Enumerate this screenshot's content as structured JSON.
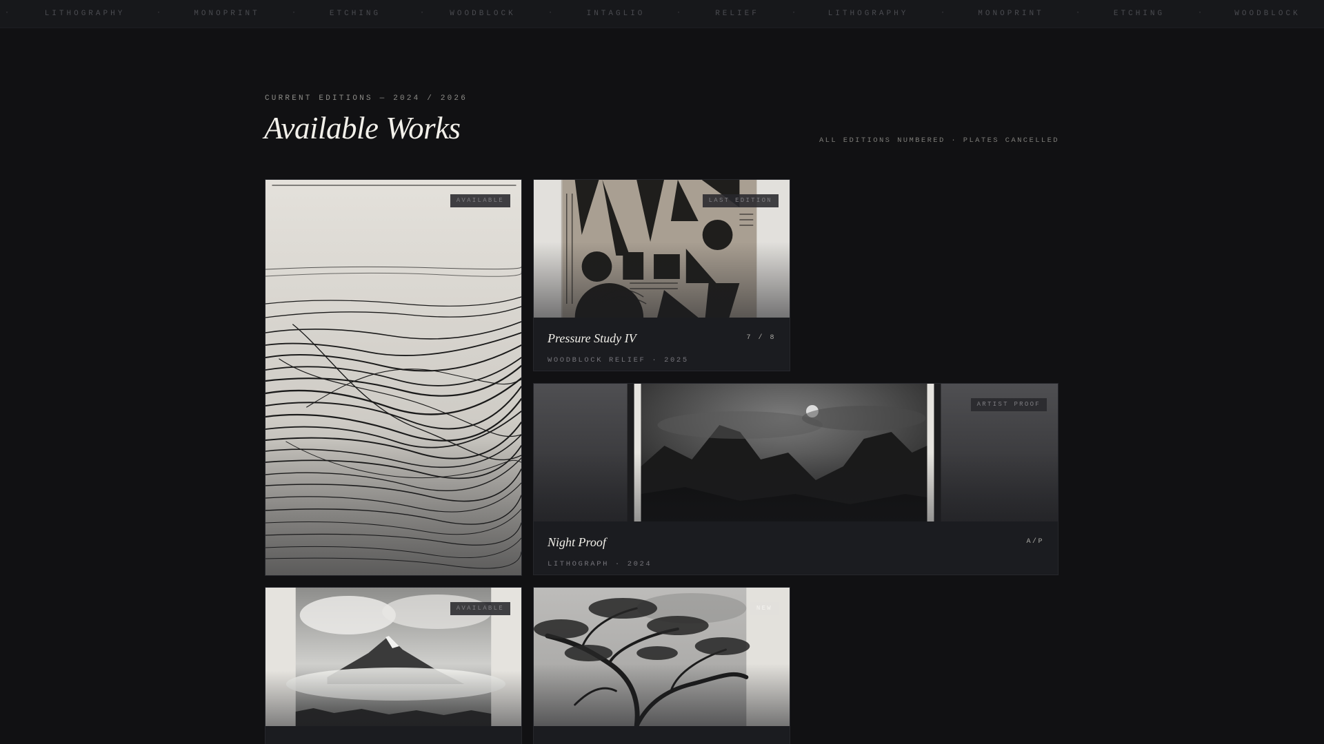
{
  "ticker": {
    "items": [
      "LITHOGRAPHY",
      "MONOPRINT",
      "ETCHING",
      "WOODBLOCK",
      "INTAGLIO",
      "RELIEF",
      "LITHOGRAPHY",
      "MONOPRINT",
      "ETCHING",
      "WOODBLOCK"
    ],
    "separator": "·"
  },
  "header": {
    "eyebrow": "CURRENT EDITIONS — 2024 / 2026",
    "title": "Available Works",
    "note": "ALL EDITIONS NUMBERED · PLATES CANCELLED"
  },
  "works": [
    {
      "badge": "AVAILABLE",
      "art": "ink-lines-print"
    },
    {
      "badge": "LAST EDITION",
      "art": "geometric-woodblock",
      "title": "Pressure Study IV",
      "edition": "7 / 8",
      "meta": "WOODBLOCK RELIEF · 2025"
    },
    {
      "badge": "ARTIST PROOF",
      "art": "moonlit-mountains",
      "title": "Night Proof",
      "edition": "A/P",
      "meta": "LITHOGRAPH · 2024"
    },
    {
      "badge": "AVAILABLE",
      "art": "mountain-in-clouds"
    },
    {
      "badge": "NEW",
      "art": "windswept-tree"
    }
  ],
  "colors": {
    "background": "#111113",
    "card": "#1b1c20",
    "accent_text": "#f2f0ea"
  }
}
